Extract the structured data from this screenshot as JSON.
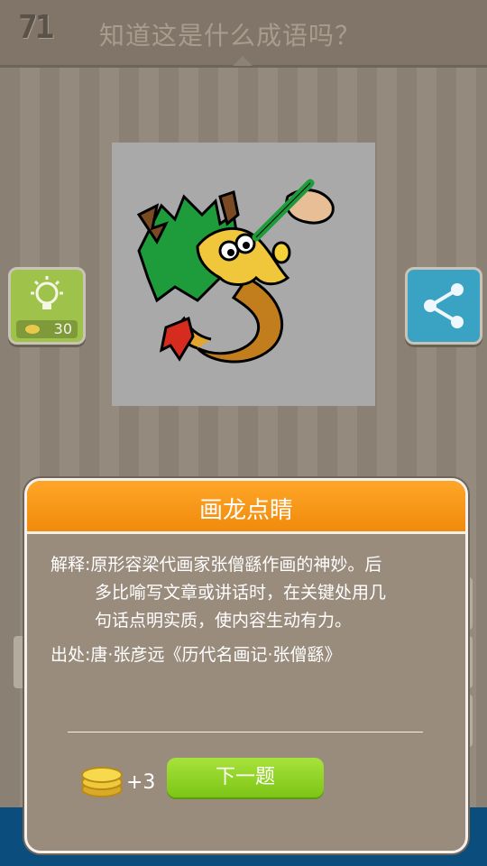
{
  "header": {
    "level": "71",
    "question": "知道这是什么成语吗？"
  },
  "hint": {
    "icon": "lightbulb-icon",
    "cost": "30"
  },
  "share": {
    "icon": "share-icon"
  },
  "modal": {
    "title": "画龙点睛",
    "explain_label": "解释:",
    "explain_lines": [
      "原形容梁代画家张僧繇作画的神妙。后",
      "多比喻写文章或讲话时，在关键处用几",
      "句话点明实质，使内容生动有力。"
    ],
    "source": "出处:唐·张彦远《历代名画记·张僧繇》",
    "reward": "+3",
    "next_label": "下一题"
  },
  "colors": {
    "header_orange": "#f7941d",
    "next_green": "#8fd321",
    "hint_green": "#9fc34a",
    "share_blue": "#3aa3c4"
  }
}
